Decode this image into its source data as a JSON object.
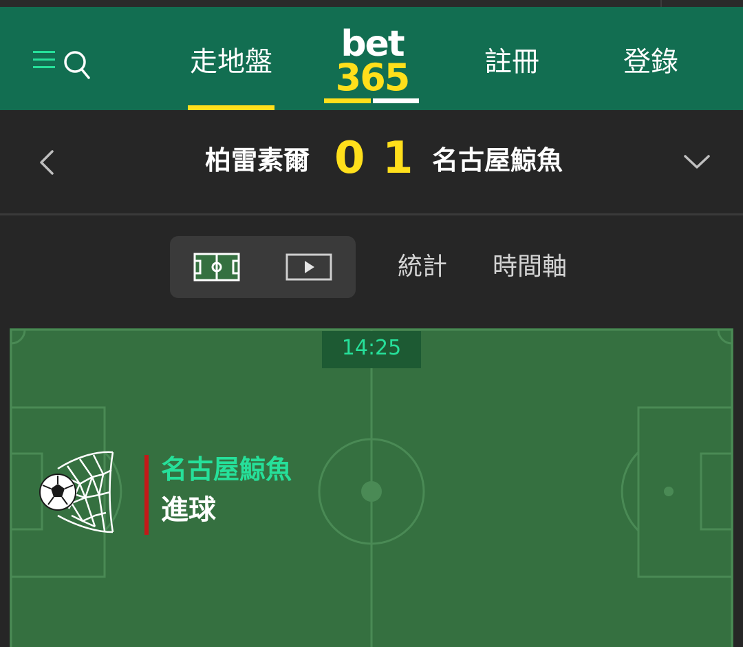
{
  "header": {
    "nav": {
      "in_play": "走地盤",
      "register": "註冊",
      "login": "登錄"
    },
    "logo": {
      "line1": "bet",
      "line2": "365"
    },
    "icons": [
      "menu-icon",
      "search-icon"
    ]
  },
  "match": {
    "home_team": "柏雷素爾",
    "away_team": "名古屋鯨魚",
    "home_score": "0",
    "away_score": "1"
  },
  "view_tabs": {
    "pitch_view_icon": "pitch-icon",
    "video_icon": "play-icon",
    "stats": "統計",
    "timeline": "時間軸"
  },
  "pitch": {
    "clock": "14:25",
    "event_team": "名古屋鯨魚",
    "event_type": "進球"
  },
  "colors": {
    "header_green": "#126e51",
    "accent_yellow": "#ffdf1b",
    "pitch_green": "#357040",
    "event_green": "#26e09a",
    "goal_bar_red": "#c41818",
    "background": "#262626"
  }
}
